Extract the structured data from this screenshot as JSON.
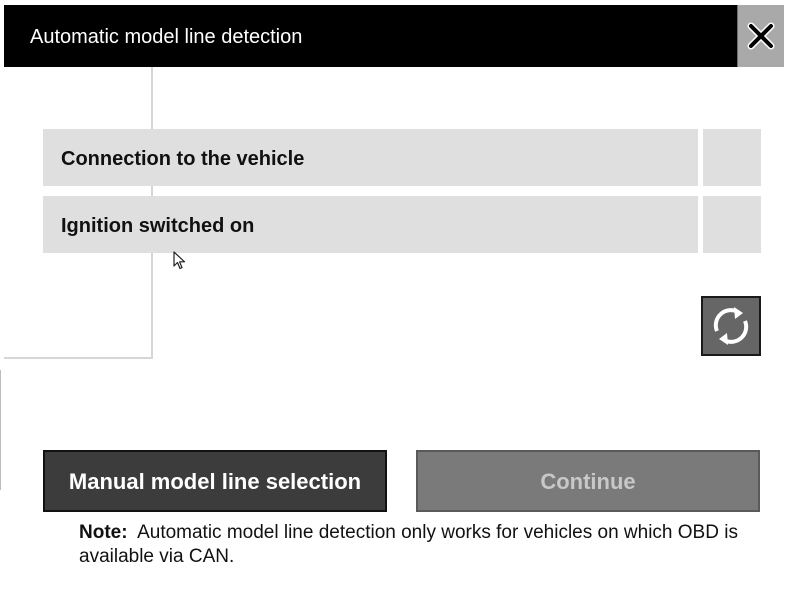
{
  "dialog": {
    "title": "Automatic model line detection",
    "close_icon": "close-x-icon"
  },
  "checks": [
    {
      "label": "Connection to the vehicle",
      "status": ""
    },
    {
      "label": "Ignition switched on",
      "status": ""
    }
  ],
  "refresh": {
    "icon": "refresh-icon"
  },
  "buttons": {
    "manual_label": "Manual model line selection",
    "continue_label": "Continue",
    "continue_enabled": false
  },
  "note": {
    "prefix": "Note:",
    "text": "Automatic model line detection only works for vehicles on which OBD is available via CAN."
  },
  "colors": {
    "titlebar": "#000000",
    "row_background": "#dfdfdf",
    "primary_button": "#3c3c3c",
    "disabled_button": "#7a7a7a"
  }
}
